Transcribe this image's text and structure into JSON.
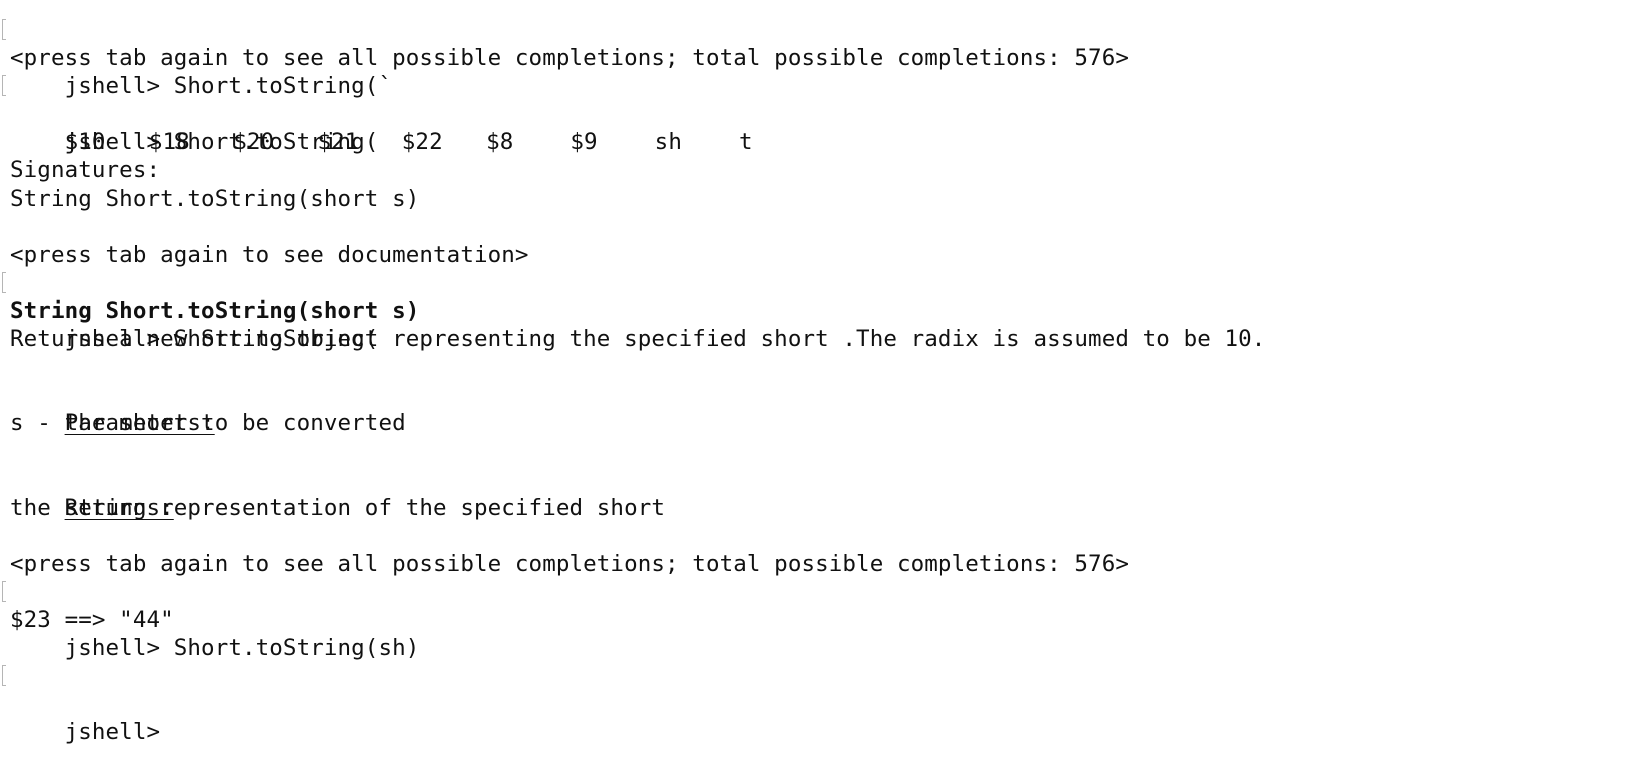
{
  "session": {
    "line1": "jshell> Short.toString(`",
    "line2": "<press tab again to see all possible completions; total possible completions: 576>",
    "line3": "jshell> Short.toString(",
    "completions": [
      "$10",
      "$18",
      "$20",
      "$21",
      "$22",
      "$8",
      "$9",
      "sh",
      "t"
    ],
    "signatures_header": "Signatures:",
    "signature": "String Short.toString(short s)",
    "press_doc": "<press tab again to see documentation>",
    "line10": "jshell> Short.toString(",
    "doc_signature": "String Short.toString(short s)",
    "doc_description": "Returns a new String object representing the specified short .The radix is assumed to be 10.",
    "parameters_header": "Parameters:",
    "parameter_desc": "s - the short to be converted",
    "returns_header": "Returns:",
    "returns_desc": "the string representation of the specified short",
    "press_completions": "<press tab again to see all possible completions; total possible completions: 576>",
    "line21": "jshell> Short.toString(sh)",
    "result": "$23 ==> \"44\"",
    "final_prompt": "jshell>"
  }
}
